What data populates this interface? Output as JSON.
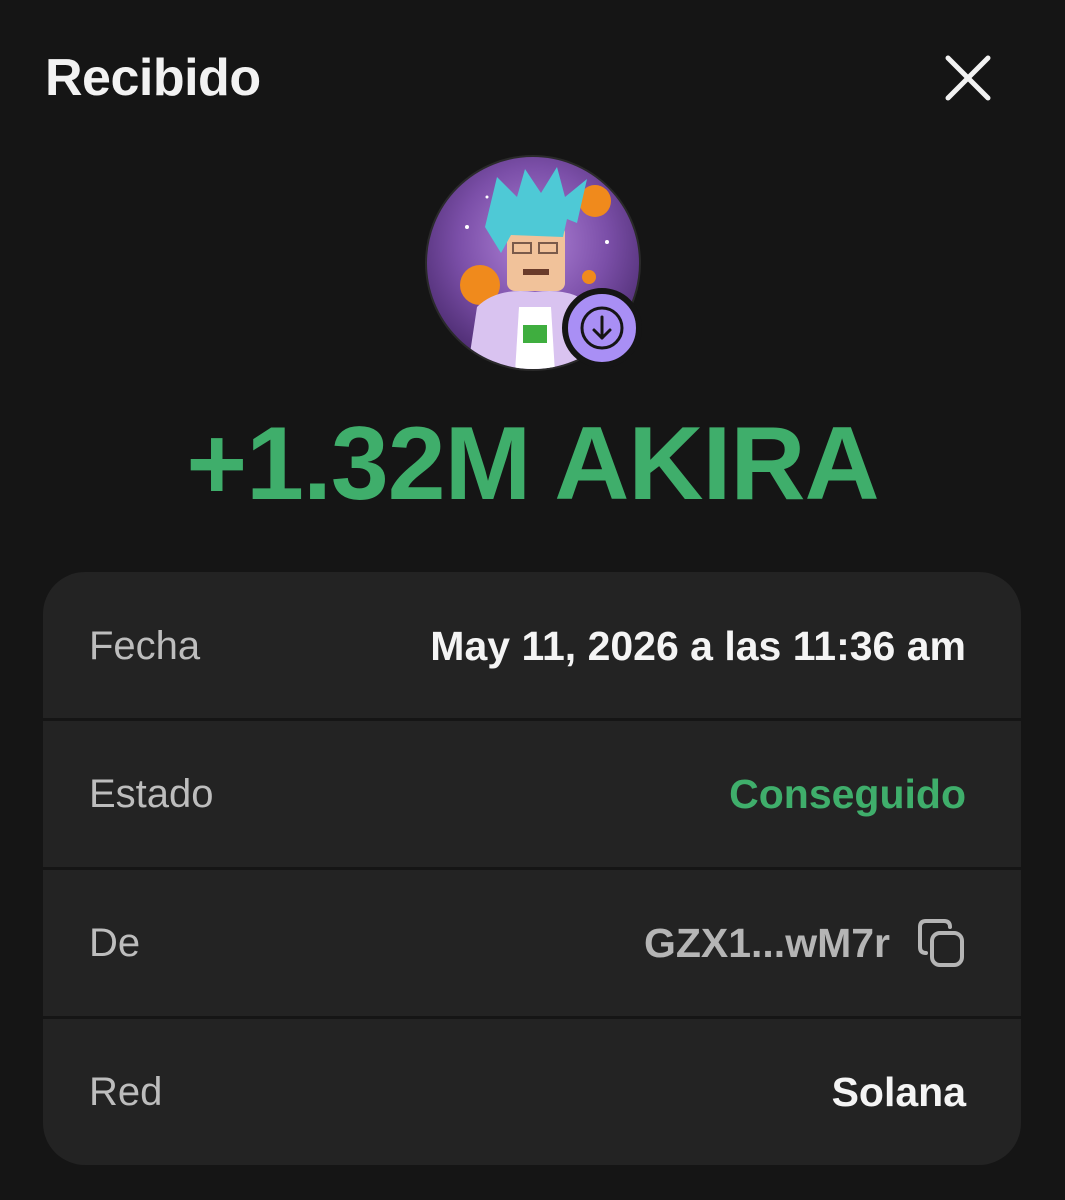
{
  "header": {
    "title": "Recibido"
  },
  "transaction": {
    "amount": "+1.32M AKIRA"
  },
  "details": {
    "fecha_label": "Fecha",
    "fecha_value": "May 11, 2026 a las 11:36 am",
    "estado_label": "Estado",
    "estado_value": "Conseguido",
    "de_label": "De",
    "de_value": "GZX1...wM7r",
    "red_label": "Red",
    "red_value": "Solana"
  },
  "icons": {
    "close": "close-icon",
    "receive": "arrow-down-icon",
    "copy": "copy-icon"
  },
  "colors": {
    "background": "#151515",
    "card": "#232323",
    "success": "#3fae6b",
    "badge": "#a98ff5"
  }
}
